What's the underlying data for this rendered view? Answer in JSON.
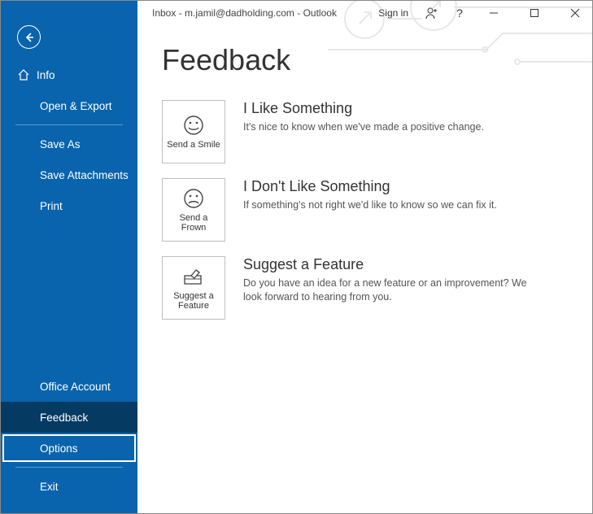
{
  "titlebar": {
    "text": "Inbox - m.jamil@dadholding.com - Outlook",
    "signin": "Sign in"
  },
  "sidebar": {
    "info": "Info",
    "open_export": "Open & Export",
    "save_as": "Save As",
    "save_attachments": "Save Attachments",
    "print": "Print",
    "office_account": "Office Account",
    "feedback": "Feedback",
    "options": "Options",
    "exit": "Exit"
  },
  "page": {
    "heading": "Feedback"
  },
  "items": {
    "smile": {
      "card_label": "Send a Smile",
      "title": "I Like Something",
      "desc": "It's nice to know when we've made a positive change."
    },
    "frown": {
      "card_label": "Send a Frown",
      "title": "I Don't Like Something",
      "desc": "If something's not right we'd like to know so we can fix it."
    },
    "suggest": {
      "card_label": "Suggest a Feature",
      "title": "Suggest a Feature",
      "desc": "Do you have an idea for a new feature or an improvement? We look forward to hearing from you."
    }
  }
}
